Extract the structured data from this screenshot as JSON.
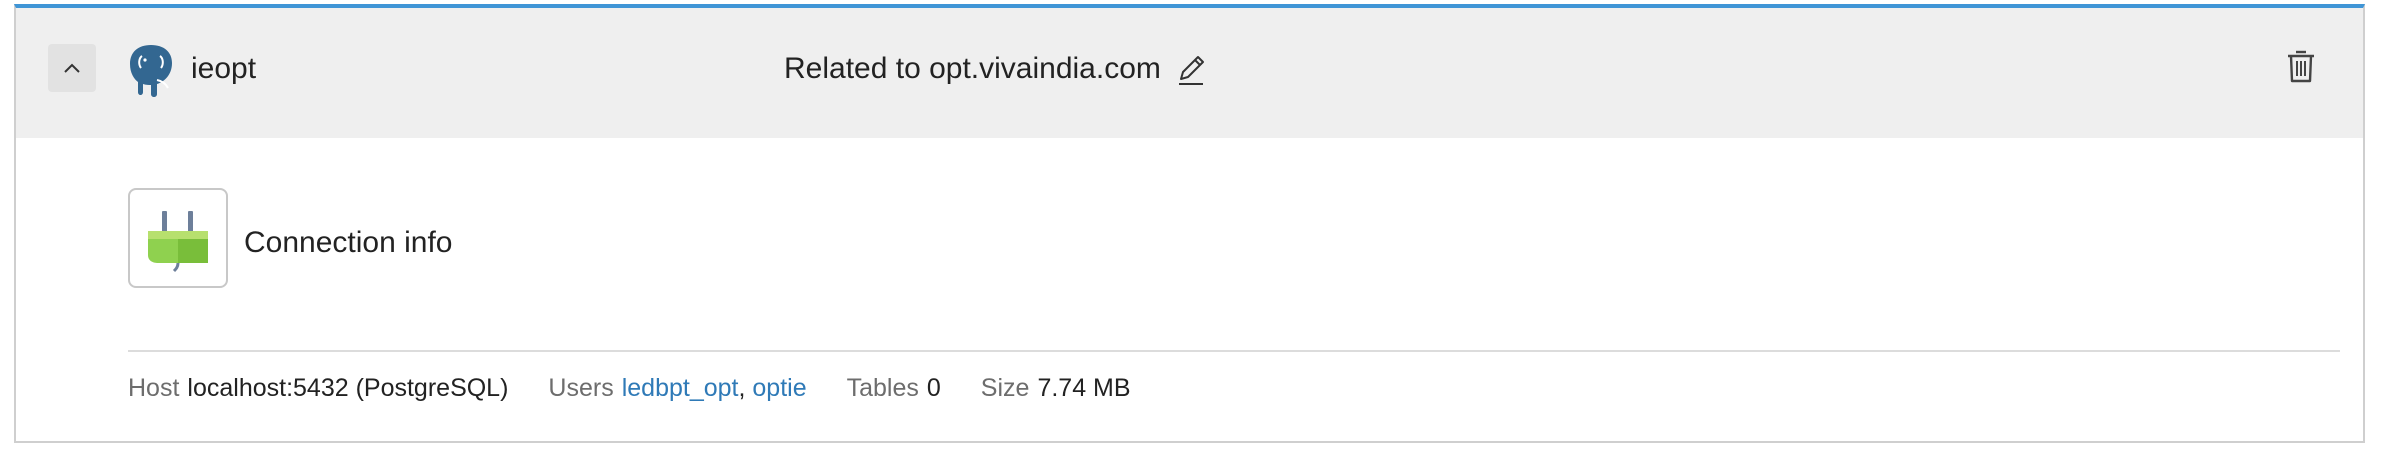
{
  "header": {
    "db_name": "ieopt",
    "related_text": "Related to opt.vivaindia.com"
  },
  "connection": {
    "title": "Connection info"
  },
  "meta": {
    "host_label": "Host",
    "host_value": "localhost:5432 (PostgreSQL)",
    "users_label": "Users",
    "users": [
      "ledbpt_opt",
      "optie"
    ],
    "users_separator": ", ",
    "tables_label": "Tables",
    "tables_value": "0",
    "size_label": "Size",
    "size_value": "7.74 MB"
  },
  "icons": {
    "collapse": "chevron-up-icon",
    "database": "postgresql-elephant-icon",
    "edit": "pencil-icon",
    "delete": "trash-icon",
    "connection": "plug-icon"
  },
  "colors": {
    "accent_top_border": "#3f95d6",
    "link": "#2f7ab7",
    "header_bg": "#efefef"
  }
}
